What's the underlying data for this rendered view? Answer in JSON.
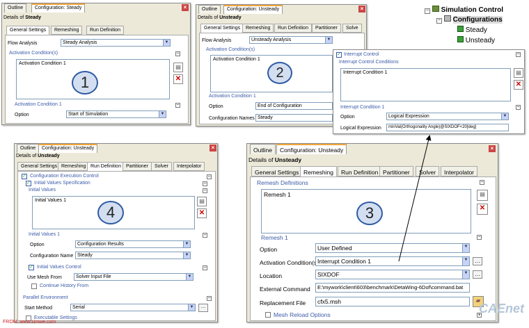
{
  "p1": {
    "tabs": [
      "Outline",
      "Configuration: Steady"
    ],
    "details_prefix": "Details of ",
    "details_name": "Steady",
    "itabs": [
      "General Settings",
      "Remeshing",
      "Run Definition"
    ],
    "flow_label": "Flow Analysis",
    "flow_value": "Steady Analysis",
    "activation_conditions_title": "Activation Condition(s)",
    "list_item": "Activation Condition 1",
    "activation_cond_title": "Activation Condition 1",
    "option_label": "Option",
    "option_value": "Start of Simulation",
    "badge": "1"
  },
  "p2": {
    "tabs": [
      "Outline",
      "Configuration: Unsteady"
    ],
    "details_prefix": "Details of ",
    "details_name": "Unsteady",
    "itabs": [
      "General Settings",
      "Remeshing",
      "Run Definition",
      "Partitioner",
      "Solve"
    ],
    "flow_label": "Flow Analysis",
    "flow_value": "Unsteady Analysis",
    "activation_conditions_title": "Activation Condition(s)",
    "list_item": "Activation Condition 1",
    "activation_cond_title": "Activation Condition 1",
    "option_label": "Option",
    "option_value": "End of Configuration",
    "config_names_label": "Configuration Names",
    "config_names_value": "Steady",
    "badge": "2"
  },
  "interrupt": {
    "checkbox_label": "Interrupt Control",
    "conditions_title": "Interrupt Control Conditions",
    "list_item": "Interrupt Condition 1",
    "cond_title": "Interrupt Condition 1",
    "option_label": "Option",
    "option_value": "Logical Expression",
    "expr_label": "Logical Expression",
    "expr_value": "minVal(Orthogonality Angle)@SIXDOF<20[deg]"
  },
  "tree": {
    "root": "Simulation Control",
    "configs": "Configurations",
    "items": [
      "Steady",
      "Unsteady"
    ]
  },
  "p4": {
    "tabs": [
      "Outline",
      "Configuration: Unsteady"
    ],
    "details_prefix": "Details of ",
    "details_name": "Unsteady",
    "itabs": [
      "General Settings",
      "Remeshing",
      "Run Definition",
      "Partitioner",
      "Solver",
      "Interpolator"
    ],
    "cec_label": "Configuration Execution Control",
    "ivs_label": "Initial Values Specification",
    "initial_values_title": "Initial Values",
    "list_item": "Initial Values 1",
    "iv1_title": "Initial Values 1",
    "option_label": "Option",
    "option_value": "Configuration Results",
    "config_name_label": "Configuration Name",
    "config_name_value": "Steady",
    "ivc_label": "Initial Values Control",
    "mesh_label": "Use Mesh From",
    "mesh_value": "Solver Input File",
    "continue_label": "Continue History From",
    "parallel_title": "Parallel Environment",
    "start_label": "Start Method",
    "start_value": "Serial",
    "exec_label": "Executable Settings",
    "badge": "4"
  },
  "p3": {
    "tabs": [
      "Outline",
      "Configuration: Unsteady"
    ],
    "details_prefix": "Details of ",
    "details_name": "Unsteady",
    "itabs": [
      "General Settings",
      "Remeshing",
      "Run Definition",
      "Partitioner",
      "Solver",
      "Interpolator"
    ],
    "remesh_defs_title": "Remesh Definitions",
    "list_item": "Remesh 1",
    "remesh1_title": "Remesh 1",
    "option_label": "Option",
    "option_value": "User Defined",
    "act_label": "Activation Condition(s)",
    "act_value": "Interrupt Condition 1",
    "location_label": "Location",
    "location_value": "SIXDOF",
    "ext_label": "External Command",
    "ext_value": "E:\\mywork\\client\\603\\benchmark\\DetaWing-6Dof\\command.bat",
    "repl_label": "Replacement File",
    "repl_value": "cfx5.msh",
    "reload_label": "Mesh Reload Options",
    "badge": "3"
  },
  "watermark": {
    "from": "FROM: www.simwe.com",
    "logo": "CAEnet"
  }
}
